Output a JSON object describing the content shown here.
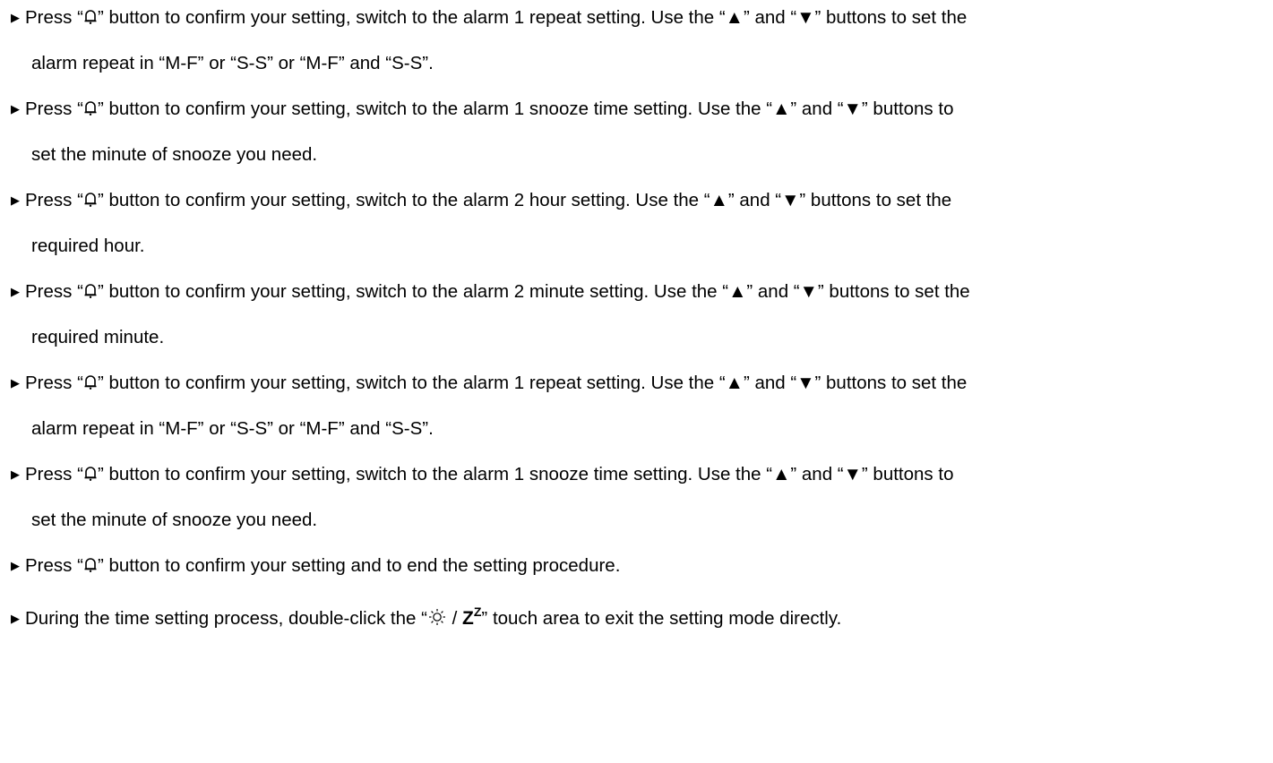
{
  "instructions": [
    {
      "prefix": "Press “",
      "icon": "bell-icon",
      "line1": "” button to confirm your setting, switch to the alarm 1 repeat setting. Use the “▲” and “▼” buttons to set the",
      "line2": "alarm repeat in “M-F” or “S-S” or “M-F” and “S-S”."
    },
    {
      "prefix": "Press “",
      "icon": "bell-icon",
      "line1": "” button to confirm your setting, switch to the alarm 1 snooze time setting. Use the “▲” and “▼” buttons to",
      "line2": "set the minute of snooze you need."
    },
    {
      "prefix": "Press “",
      "icon": "bell-icon",
      "line1": "” button to confirm your setting, switch to the alarm 2 hour setting. Use the “▲” and “▼” buttons to set the",
      "line2": "required hour."
    },
    {
      "prefix": "Press “",
      "icon": "bell-icon",
      "line1": "” button to confirm your setting, switch to the alarm 2 minute setting. Use the “▲” and “▼” buttons to set the",
      "line2": "required minute."
    },
    {
      "prefix": "Press “",
      "icon": "bell-icon",
      "line1": "” button to confirm your setting, switch to the alarm 1 repeat setting. Use the “▲” and “▼” buttons to set the",
      "line2": "alarm repeat in “M-F” or “S-S” or “M-F” and “S-S”."
    },
    {
      "prefix": "Press “",
      "icon": "bell-icon",
      "line1": "” button to confirm your setting, switch to the alarm 1 snooze time setting. Use the “▲” and “▼” buttons to",
      "line2": "set the minute of snooze you need."
    },
    {
      "prefix": "Press “",
      "icon": "bell-icon",
      "line1": "” button to confirm your setting and to end the setting procedure."
    }
  ],
  "final_instruction": {
    "prefix": "During the time setting process, double-click the “",
    "icon": "light-snooze-icon",
    "z_big": "Z",
    "z_small": "Z",
    "suffix": "” touch area to exit the setting mode directly."
  },
  "bullet_symbol": "▶"
}
